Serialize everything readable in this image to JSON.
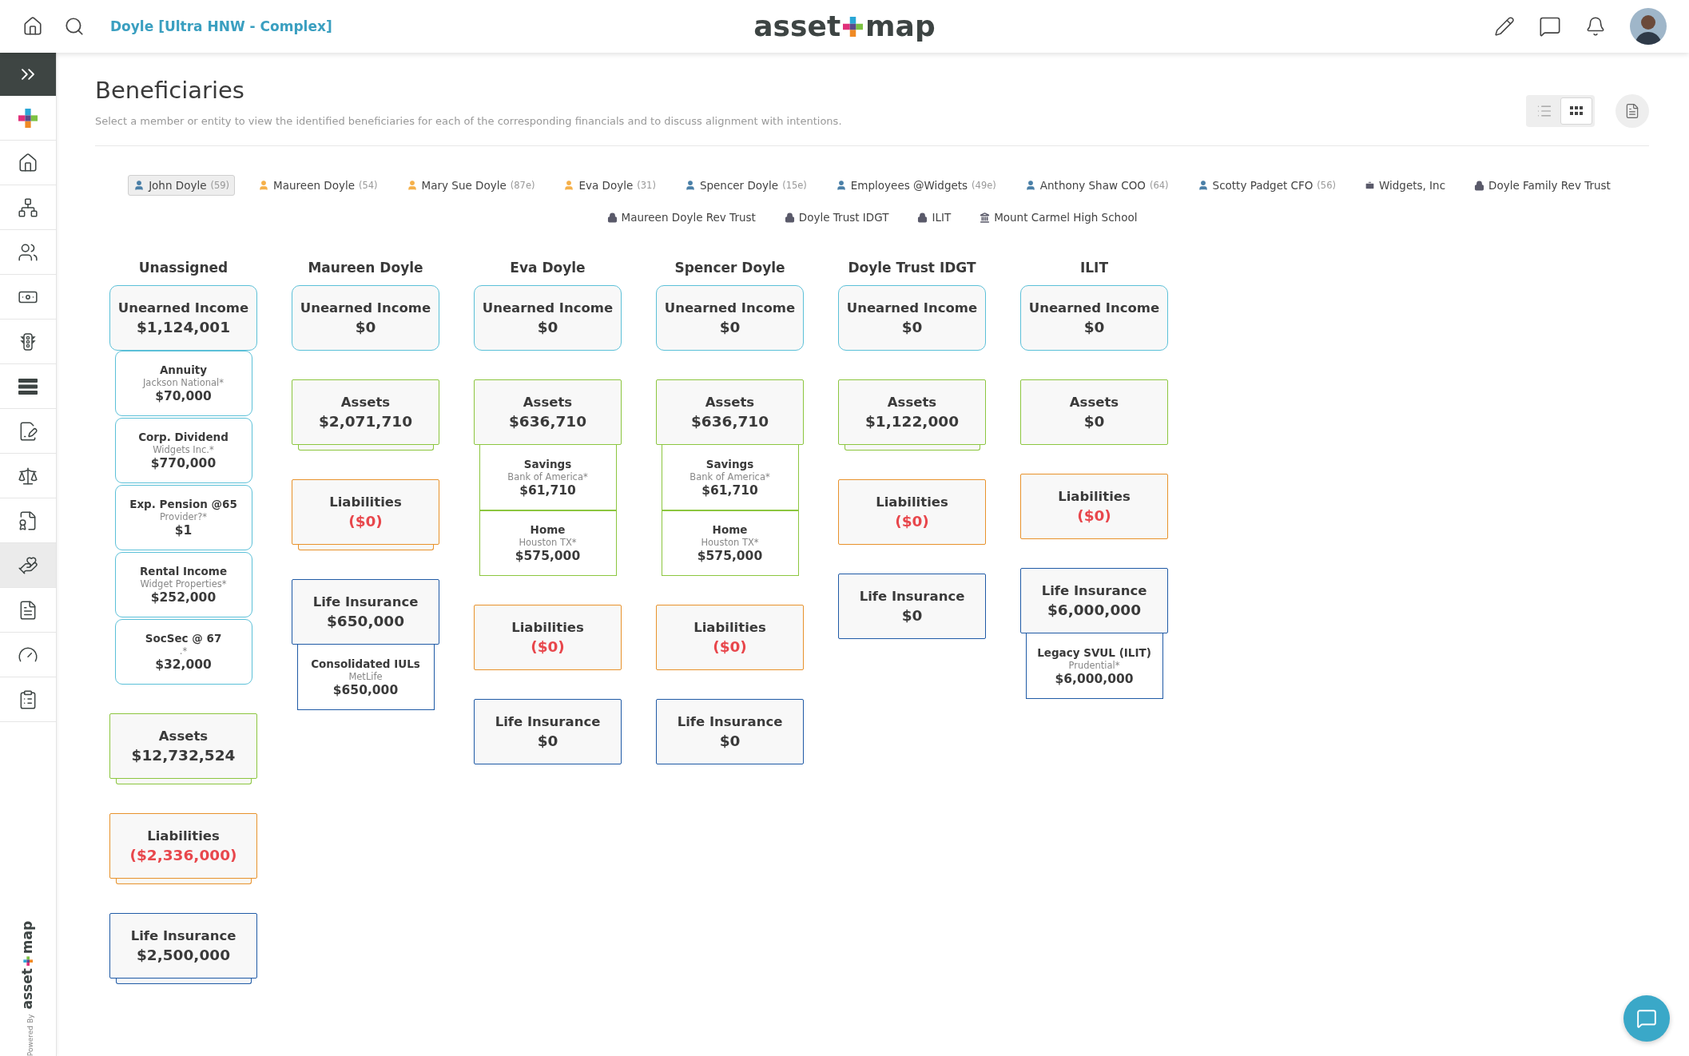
{
  "topbar": {
    "client": "Doyle [Ultra HNW - Complex]",
    "logo": {
      "left": "asset",
      "right": "map"
    }
  },
  "sidebar": {
    "items": [
      {
        "selected": false
      },
      {
        "selected": false
      },
      {
        "selected": false
      },
      {
        "selected": false
      },
      {
        "selected": false
      },
      {
        "selected": false
      },
      {
        "selected": false
      },
      {
        "selected": false
      },
      {
        "selected": false
      },
      {
        "selected": true
      },
      {
        "selected": false
      },
      {
        "selected": false
      },
      {
        "selected": false
      }
    ],
    "powered_by": "Powered By",
    "logo": {
      "left": "asset",
      "right": "map"
    }
  },
  "page": {
    "title": "Beneficiaries",
    "subtitle": "Select a member or entity to view the identified beneficiaries for each of the corresponding financials and to discuss alignment with intentions.",
    "view_toggle": [
      {
        "kind": "list",
        "selected": false
      },
      {
        "kind": "grid",
        "selected": true
      }
    ]
  },
  "members": [
    {
      "kind": "person",
      "name": "John Doyle",
      "age": "(59)",
      "color": "#4a7fa7",
      "selected": true
    },
    {
      "kind": "person",
      "name": "Maureen Doyle",
      "age": "(54)",
      "color": "#f5b04a",
      "selected": false
    },
    {
      "kind": "person",
      "name": "Mary Sue Doyle",
      "age": "(87e)",
      "color": "#f5b04a",
      "selected": false
    },
    {
      "kind": "person",
      "name": "Eva Doyle",
      "age": "(31)",
      "color": "#f5b04a",
      "selected": false
    },
    {
      "kind": "person",
      "name": "Spencer Doyle",
      "age": "(15e)",
      "color": "#4a7fa7",
      "selected": false
    },
    {
      "kind": "person",
      "name": "Employees @Widgets",
      "age": "(49e)",
      "color": "#4a7fa7",
      "selected": false
    },
    {
      "kind": "person",
      "name": "Anthony Shaw COO",
      "age": "(64)",
      "color": "#4a7fa7",
      "selected": false
    },
    {
      "kind": "person",
      "name": "Scotty Padget CFO",
      "age": "(56)",
      "color": "#4a7fa7",
      "selected": false
    },
    {
      "kind": "business",
      "name": "Widgets, Inc",
      "color": "#5a5a6a",
      "selected": false
    },
    {
      "kind": "trust",
      "name": "Doyle Family Rev Trust",
      "color": "#5a5a6a",
      "selected": false
    },
    {
      "kind": "trust",
      "name": "Maureen Doyle Rev Trust",
      "color": "#5a5a6a",
      "selected": false
    },
    {
      "kind": "trust",
      "name": "Doyle Trust IDGT",
      "color": "#5a5a6a",
      "selected": false
    },
    {
      "kind": "trust",
      "name": "ILIT",
      "color": "#5a5a6a",
      "selected": false
    },
    {
      "kind": "charity",
      "name": "Mount Carmel High School",
      "color": "#5a5a6a",
      "selected": false
    }
  ],
  "columns": [
    {
      "header": "Unassigned",
      "sections": [
        {
          "kind": "income",
          "label": "Unearned Income",
          "amount": "$1,124,001",
          "items": [
            {
              "name": "Annuity",
              "provider": "Jackson National*",
              "amount": "$70,000"
            },
            {
              "name": "Corp. Dividend",
              "provider": "Widgets Inc.*",
              "amount": "$770,000"
            },
            {
              "name": "Exp. Pension @65",
              "provider": "Provider?*",
              "amount": "$1"
            },
            {
              "name": "Rental Income",
              "provider": "Widget Properties*",
              "amount": "$252,000"
            },
            {
              "name": "SocSec @ 67",
              "provider": ".*",
              "amount": "$32,000"
            }
          ]
        },
        {
          "kind": "assets",
          "label": "Assets",
          "amount": "$12,732,524",
          "collapsed": true
        },
        {
          "kind": "liabilities",
          "label": "Liabilities",
          "amount": "($2,336,000)",
          "collapsed": true
        },
        {
          "kind": "insurance",
          "label": "Life Insurance",
          "amount": "$2,500,000",
          "collapsed": true
        }
      ]
    },
    {
      "header": "Maureen Doyle",
      "sections": [
        {
          "kind": "income",
          "label": "Unearned Income",
          "amount": "$0"
        },
        {
          "kind": "assets",
          "label": "Assets",
          "amount": "$2,071,710",
          "collapsed": true
        },
        {
          "kind": "liabilities",
          "label": "Liabilities",
          "amount": "($0)",
          "collapsed": true
        },
        {
          "kind": "insurance",
          "label": "Life Insurance",
          "amount": "$650,000",
          "items": [
            {
              "name": "Consolidated IULs",
              "provider": "MetLife",
              "amount": "$650,000"
            }
          ]
        }
      ]
    },
    {
      "header": "Eva Doyle",
      "sections": [
        {
          "kind": "income",
          "label": "Unearned Income",
          "amount": "$0"
        },
        {
          "kind": "assets",
          "label": "Assets",
          "amount": "$636,710",
          "items": [
            {
              "name": "Savings",
              "provider": "Bank of America*",
              "amount": "$61,710"
            },
            {
              "name": "Home",
              "provider": "Houston TX*",
              "amount": "$575,000"
            }
          ]
        },
        {
          "kind": "liabilities",
          "label": "Liabilities",
          "amount": "($0)"
        },
        {
          "kind": "insurance",
          "label": "Life Insurance",
          "amount": "$0"
        }
      ]
    },
    {
      "header": "Spencer Doyle",
      "sections": [
        {
          "kind": "income",
          "label": "Unearned Income",
          "amount": "$0"
        },
        {
          "kind": "assets",
          "label": "Assets",
          "amount": "$636,710",
          "items": [
            {
              "name": "Savings",
              "provider": "Bank of America*",
              "amount": "$61,710"
            },
            {
              "name": "Home",
              "provider": "Houston TX*",
              "amount": "$575,000"
            }
          ]
        },
        {
          "kind": "liabilities",
          "label": "Liabilities",
          "amount": "($0)"
        },
        {
          "kind": "insurance",
          "label": "Life Insurance",
          "amount": "$0"
        }
      ]
    },
    {
      "header": "Doyle Trust IDGT",
      "sections": [
        {
          "kind": "income",
          "label": "Unearned Income",
          "amount": "$0"
        },
        {
          "kind": "assets",
          "label": "Assets",
          "amount": "$1,122,000",
          "collapsed": true
        },
        {
          "kind": "liabilities",
          "label": "Liabilities",
          "amount": "($0)"
        },
        {
          "kind": "insurance",
          "label": "Life Insurance",
          "amount": "$0"
        }
      ]
    },
    {
      "header": "ILIT",
      "sections": [
        {
          "kind": "income",
          "label": "Unearned Income",
          "amount": "$0"
        },
        {
          "kind": "assets",
          "label": "Assets",
          "amount": "$0"
        },
        {
          "kind": "liabilities",
          "label": "Liabilities",
          "amount": "($0)"
        },
        {
          "kind": "insurance",
          "label": "Life Insurance",
          "amount": "$6,000,000",
          "items": [
            {
              "name": "Legacy SVUL (ILIT)",
              "provider": "Prudential*",
              "amount": "$6,000,000"
            }
          ]
        }
      ]
    }
  ]
}
